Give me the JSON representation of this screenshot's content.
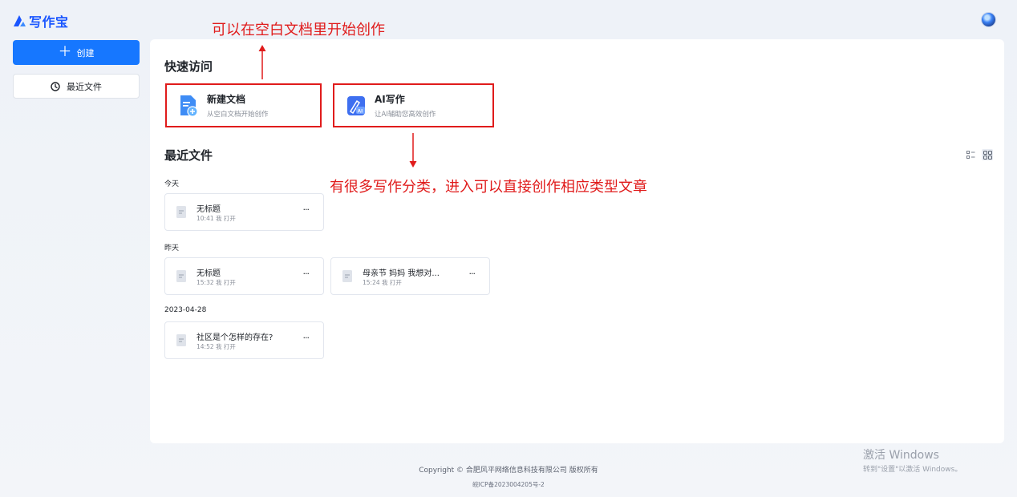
{
  "app": {
    "name": "写作宝"
  },
  "sidebar": {
    "create_label": "创建",
    "recent_label": "最近文件"
  },
  "quick_access": {
    "title": "快速访问",
    "cards": [
      {
        "title": "新建文档",
        "subtitle": "从空白文档开始创作"
      },
      {
        "title": "AI写作",
        "subtitle": "让AI辅助您高效创作"
      }
    ]
  },
  "recent": {
    "title": "最近文件",
    "groups": [
      {
        "label": "今天",
        "files": [
          {
            "name": "无标题",
            "meta": "10:41 我 打开"
          }
        ]
      },
      {
        "label": "昨天",
        "files": [
          {
            "name": "无标题",
            "meta": "15:32 我 打开"
          },
          {
            "name": "母亲节 妈妈 我想对...",
            "meta": "15:24 我 打开"
          }
        ]
      },
      {
        "label": "2023-04-28",
        "files": [
          {
            "name": "社区是个怎样的存在?",
            "meta": "14:52 我 打开"
          }
        ]
      }
    ],
    "more_label": "···"
  },
  "annotations": {
    "top": "可以在空白文档里开始创作",
    "middle": "有很多写作分类，进入可以直接创作相应类型文章"
  },
  "footer": {
    "copyright": "Copyright © 合肥风平网络信息科技有限公司 版权所有",
    "icp": "皖ICP备2023004205号-2"
  },
  "watermark": {
    "line1": "激活 Windows",
    "line2": "转到\"设置\"以激活 Windows。"
  },
  "colors": {
    "accent": "#1677ff",
    "annotation": "#e01b1b"
  }
}
